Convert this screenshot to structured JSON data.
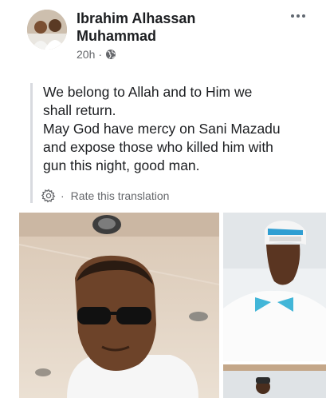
{
  "post": {
    "author": {
      "name": "Ibrahim Alhassan Muhammad",
      "avatar_icon": "profile-photo"
    },
    "timestamp": "20h",
    "meta_separator": "·",
    "privacy_icon": "globe-icon",
    "more_icon": "more-horizontal-icon",
    "text_lines": [
      "We belong to Allah and to Him we",
      "shall return.",
      "May God have mercy on Sani Mazadu",
      "and expose those who killed him with",
      "gun this night, good man."
    ],
    "translation": {
      "settings_icon": "gear-icon",
      "separator": "·",
      "link_label": "Rate this translation"
    },
    "photos": [
      {
        "name": "photo-man-sunglasses"
      },
      {
        "name": "photo-man-cap"
      },
      {
        "name": "photo-man-third"
      }
    ]
  },
  "colors": {
    "text_primary": "#1c1e21",
    "text_secondary": "#65676b",
    "quote_bar": "#d8dadf"
  }
}
